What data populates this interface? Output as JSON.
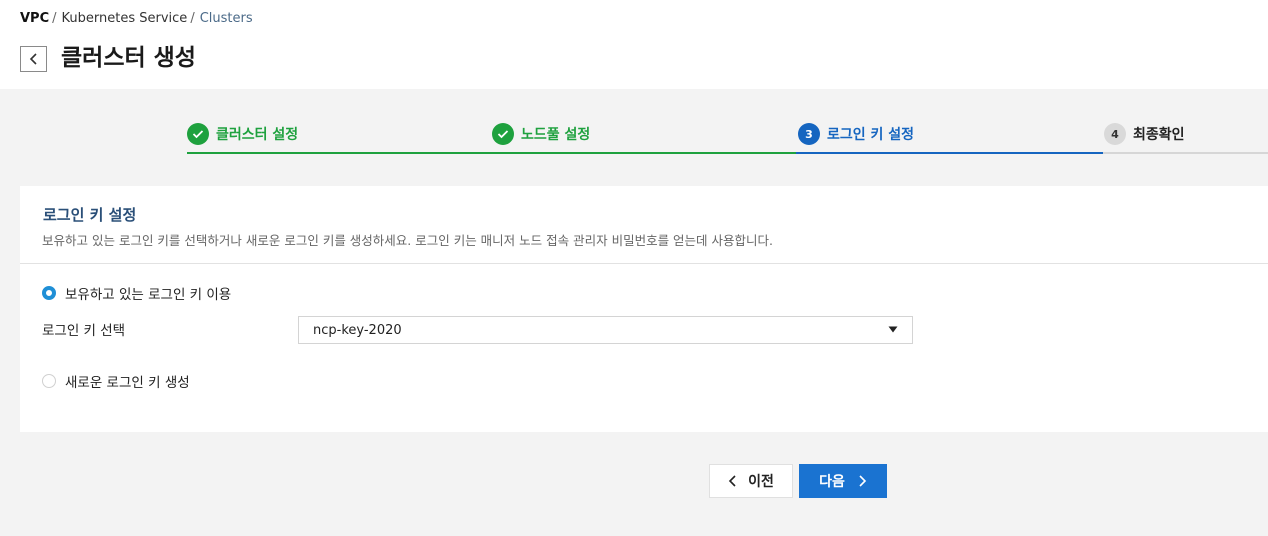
{
  "breadcrumb": {
    "items": [
      "VPC",
      "Kubernetes Service",
      "Clusters"
    ],
    "separator": "/"
  },
  "header": {
    "back_icon": "chevron-left-icon",
    "title": "클러스터 생성"
  },
  "stepper": {
    "steps": [
      {
        "number": "1",
        "label": "클러스터 설정",
        "state": "done"
      },
      {
        "number": "2",
        "label": "노드풀 설정",
        "state": "done"
      },
      {
        "number": "3",
        "label": "로그인 키 설정",
        "state": "active"
      },
      {
        "number": "4",
        "label": "최종확인",
        "state": "pending"
      }
    ]
  },
  "panel": {
    "title": "로그인 키 설정",
    "description": "보유하고 있는 로그인 키를 선택하거나 새로운 로그인 키를 생성하세요. 로그인 키는 매니저 노드 접속 관리자 비밀번호를 얻는데 사용합니다.",
    "options": {
      "existing": {
        "label": "보유하고 있는 로그인 키 이용",
        "selected": true
      },
      "new": {
        "label": "새로운 로그인 키 생성",
        "selected": false
      }
    },
    "key_select": {
      "label": "로그인 키 선택",
      "value": "ncp-key-2020"
    }
  },
  "footer": {
    "prev_label": "이전",
    "next_label": "다음"
  },
  "colors": {
    "done": "#1ea13e",
    "active": "#1565c0",
    "primary_button": "#1a73d1",
    "radio_checked": "#1f8fd6"
  }
}
